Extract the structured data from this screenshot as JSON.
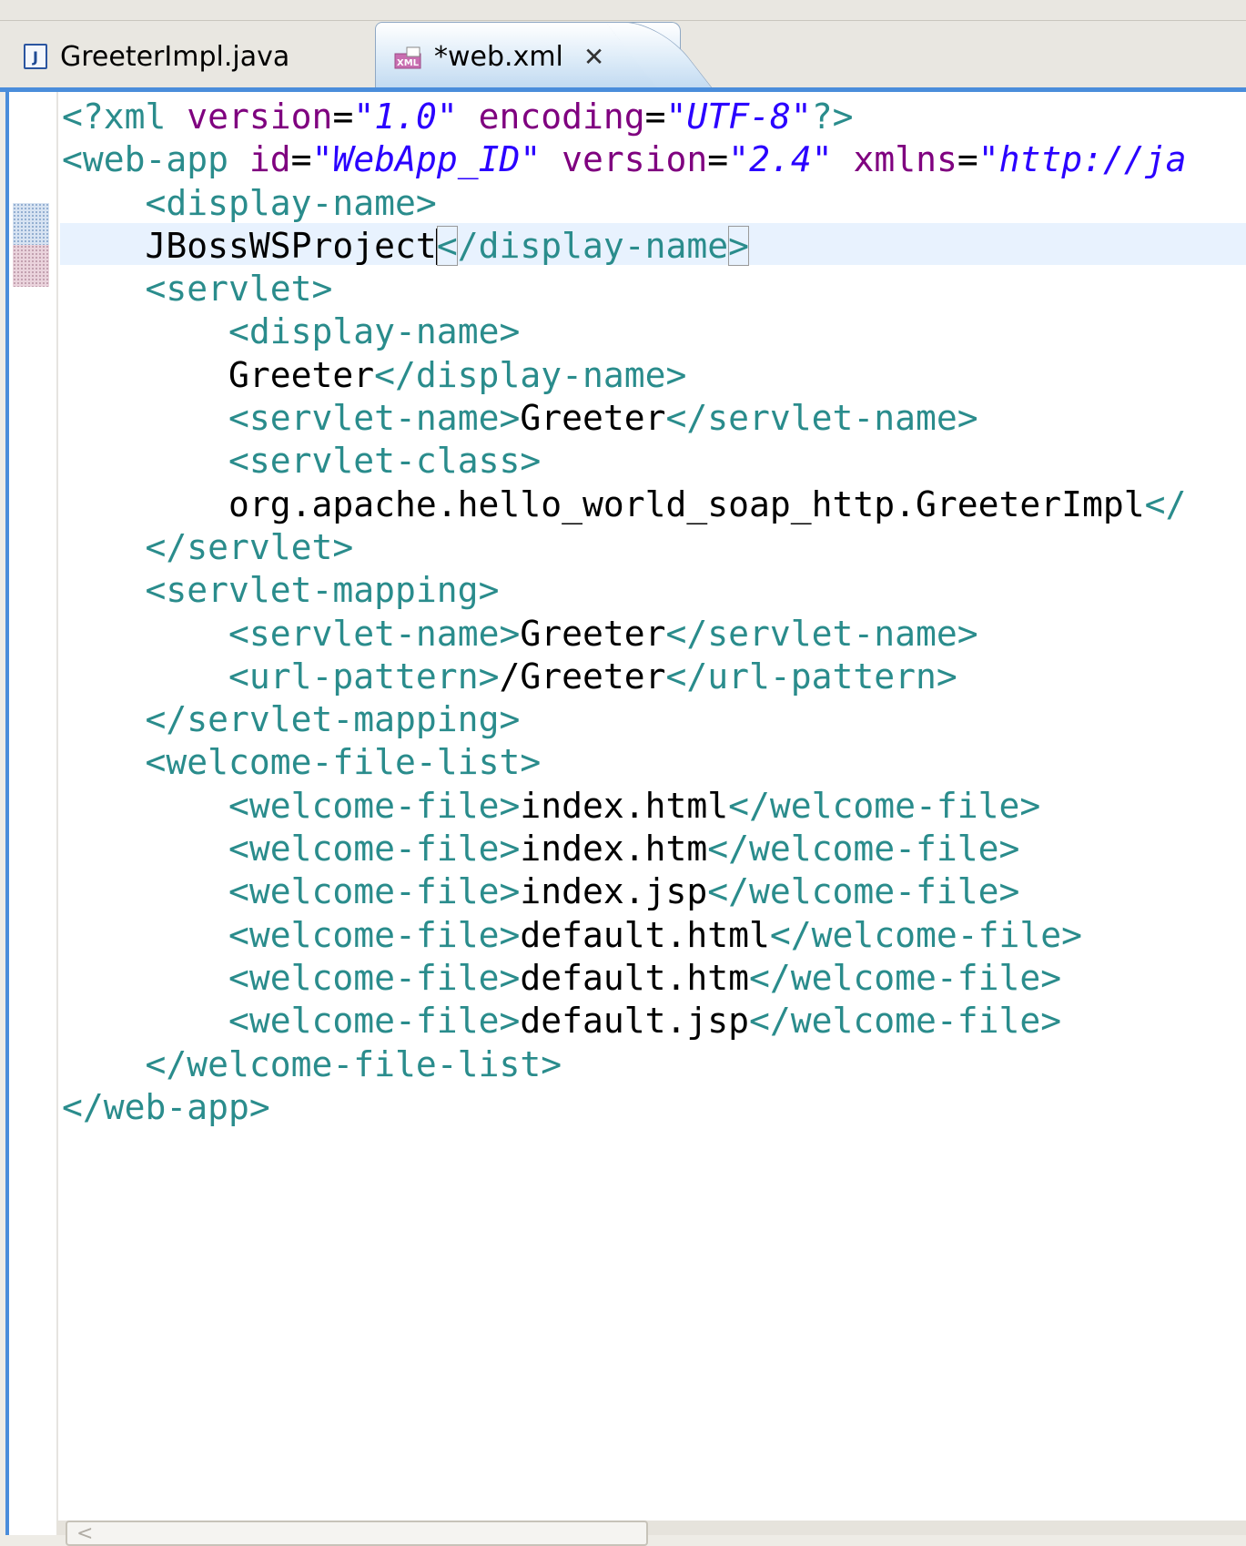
{
  "tabs": [
    {
      "label": "GreeterImpl.java",
      "icon": "java-file-icon",
      "active": false
    },
    {
      "label": "*web.xml",
      "icon": "xml-file-icon",
      "active": true,
      "close_glyph": "✕"
    }
  ],
  "editor": {
    "lines": [
      [
        {
          "c": "pi",
          "t": "<?xml "
        },
        {
          "c": "attr",
          "t": "version"
        },
        {
          "c": "eq",
          "t": "="
        },
        {
          "c": "quote",
          "t": "\""
        },
        {
          "c": "str",
          "t": "1.0"
        },
        {
          "c": "quote",
          "t": "\" "
        },
        {
          "c": "attr",
          "t": "encoding"
        },
        {
          "c": "eq",
          "t": "="
        },
        {
          "c": "quote",
          "t": "\""
        },
        {
          "c": "str",
          "t": "UTF-8"
        },
        {
          "c": "quote",
          "t": "\""
        },
        {
          "c": "pi",
          "t": "?>"
        }
      ],
      [
        {
          "c": "tag",
          "t": "<web-app "
        },
        {
          "c": "attr",
          "t": "id"
        },
        {
          "c": "eq",
          "t": "="
        },
        {
          "c": "quote",
          "t": "\""
        },
        {
          "c": "str",
          "t": "WebApp_ID"
        },
        {
          "c": "quote",
          "t": "\" "
        },
        {
          "c": "attr",
          "t": "version"
        },
        {
          "c": "eq",
          "t": "="
        },
        {
          "c": "quote",
          "t": "\""
        },
        {
          "c": "str",
          "t": "2.4"
        },
        {
          "c": "quote",
          "t": "\" "
        },
        {
          "c": "attr",
          "t": "xmlns"
        },
        {
          "c": "eq",
          "t": "="
        },
        {
          "c": "quote",
          "t": "\""
        },
        {
          "c": "str",
          "t": "http://ja"
        }
      ],
      [
        {
          "c": "txt",
          "t": "    "
        },
        {
          "c": "tag",
          "t": "<display-name>"
        }
      ],
      [
        {
          "c": "txt",
          "t": "    JBossWSProject"
        },
        {
          "c": "caret",
          "t": ""
        },
        {
          "c": "tag-box",
          "t": "<"
        },
        {
          "c": "tag",
          "t": "/display-name"
        },
        {
          "c": "tag-box",
          "t": ">"
        }
      ],
      [
        {
          "c": "txt",
          "t": "    "
        },
        {
          "c": "tag",
          "t": "<servlet>"
        }
      ],
      [
        {
          "c": "txt",
          "t": "        "
        },
        {
          "c": "tag",
          "t": "<display-name>"
        }
      ],
      [
        {
          "c": "txt",
          "t": "        Greeter"
        },
        {
          "c": "tag",
          "t": "</display-name>"
        }
      ],
      [
        {
          "c": "txt",
          "t": "        "
        },
        {
          "c": "tag",
          "t": "<servlet-name>"
        },
        {
          "c": "txt",
          "t": "Greeter"
        },
        {
          "c": "tag",
          "t": "</servlet-name>"
        }
      ],
      [
        {
          "c": "txt",
          "t": "        "
        },
        {
          "c": "tag",
          "t": "<servlet-class>"
        }
      ],
      [
        {
          "c": "txt",
          "t": "        org.apache.hello_world_soap_http.GreeterImpl"
        },
        {
          "c": "tag",
          "t": "</"
        }
      ],
      [
        {
          "c": "txt",
          "t": "    "
        },
        {
          "c": "tag",
          "t": "</servlet>"
        }
      ],
      [
        {
          "c": "txt",
          "t": "    "
        },
        {
          "c": "tag",
          "t": "<servlet-mapping>"
        }
      ],
      [
        {
          "c": "txt",
          "t": "        "
        },
        {
          "c": "tag",
          "t": "<servlet-name>"
        },
        {
          "c": "txt",
          "t": "Greeter"
        },
        {
          "c": "tag",
          "t": "</servlet-name>"
        }
      ],
      [
        {
          "c": "txt",
          "t": "        "
        },
        {
          "c": "tag",
          "t": "<url-pattern>"
        },
        {
          "c": "txt",
          "t": "/Greeter"
        },
        {
          "c": "tag",
          "t": "</url-pattern>"
        }
      ],
      [
        {
          "c": "txt",
          "t": "    "
        },
        {
          "c": "tag",
          "t": "</servlet-mapping>"
        }
      ],
      [
        {
          "c": "txt",
          "t": "    "
        },
        {
          "c": "tag",
          "t": "<welcome-file-list>"
        }
      ],
      [
        {
          "c": "txt",
          "t": "        "
        },
        {
          "c": "tag",
          "t": "<welcome-file>"
        },
        {
          "c": "txt",
          "t": "index.html"
        },
        {
          "c": "tag",
          "t": "</welcome-file>"
        }
      ],
      [
        {
          "c": "txt",
          "t": "        "
        },
        {
          "c": "tag",
          "t": "<welcome-file>"
        },
        {
          "c": "txt",
          "t": "index.htm"
        },
        {
          "c": "tag",
          "t": "</welcome-file>"
        }
      ],
      [
        {
          "c": "txt",
          "t": "        "
        },
        {
          "c": "tag",
          "t": "<welcome-file>"
        },
        {
          "c": "txt",
          "t": "index.jsp"
        },
        {
          "c": "tag",
          "t": "</welcome-file>"
        }
      ],
      [
        {
          "c": "txt",
          "t": "        "
        },
        {
          "c": "tag",
          "t": "<welcome-file>"
        },
        {
          "c": "txt",
          "t": "default.html"
        },
        {
          "c": "tag",
          "t": "</welcome-file>"
        }
      ],
      [
        {
          "c": "txt",
          "t": "        "
        },
        {
          "c": "tag",
          "t": "<welcome-file>"
        },
        {
          "c": "txt",
          "t": "default.htm"
        },
        {
          "c": "tag",
          "t": "</welcome-file>"
        }
      ],
      [
        {
          "c": "txt",
          "t": "        "
        },
        {
          "c": "tag",
          "t": "<welcome-file>"
        },
        {
          "c": "txt",
          "t": "default.jsp"
        },
        {
          "c": "tag",
          "t": "</welcome-file>"
        }
      ],
      [
        {
          "c": "txt",
          "t": "    "
        },
        {
          "c": "tag",
          "t": "</welcome-file-list>"
        }
      ],
      [
        {
          "c": "tag",
          "t": "</web-app>"
        }
      ]
    ]
  },
  "colors": {
    "tag": "#2a8c8c",
    "attribute": "#7f007f",
    "string": "#2a00ff",
    "active_tab_accent": "#4a8ddb",
    "current_line": "#e8f2fe"
  },
  "scrollbar": {
    "left_arrow": "<"
  }
}
